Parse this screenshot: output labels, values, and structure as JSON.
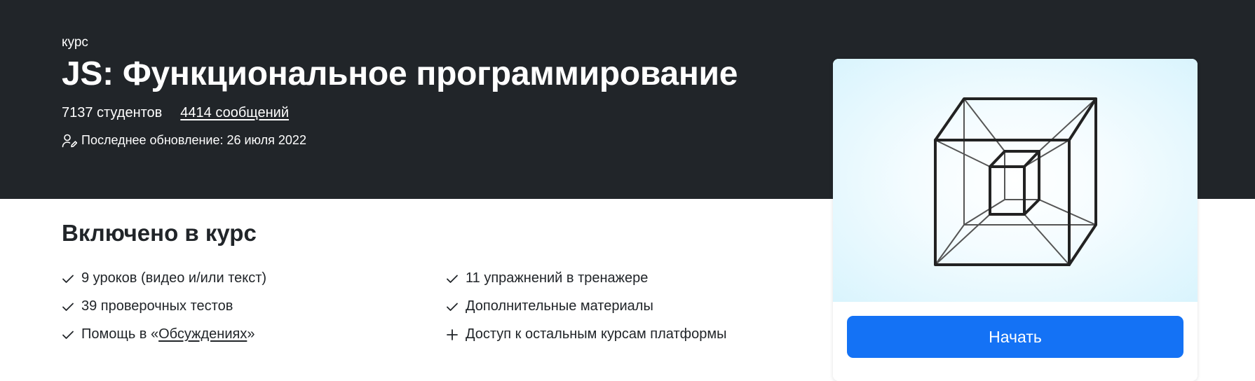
{
  "header": {
    "kind": "курс",
    "title": "JS: Функциональное программирование",
    "students": "7137 студентов",
    "messages": "4414 сообщений",
    "updated": "Последнее обновление: 26 июля 2022"
  },
  "included": {
    "title": "Включено в курс",
    "left": [
      {
        "icon": "check-icon",
        "text": "9 уроков (видео и/или текст)"
      },
      {
        "icon": "check-icon",
        "text": "39 проверочных тестов"
      },
      {
        "icon": "check-icon",
        "prefix": "Помощь в «",
        "link": "Обсуждениях",
        "suffix": "»"
      }
    ],
    "right": [
      {
        "icon": "check-icon",
        "text": "11 упражнений в тренажере"
      },
      {
        "icon": "check-icon",
        "text": "Дополнительные материалы"
      },
      {
        "icon": "plus-icon",
        "text": "Доступ к остальным курсам платформы"
      }
    ]
  },
  "card": {
    "image_icon": "tesseract-cube-illustration",
    "start_label": "Начать",
    "accent_color": "#1472f5"
  },
  "colors": {
    "hero_background": "#212529",
    "text": "#212529"
  }
}
